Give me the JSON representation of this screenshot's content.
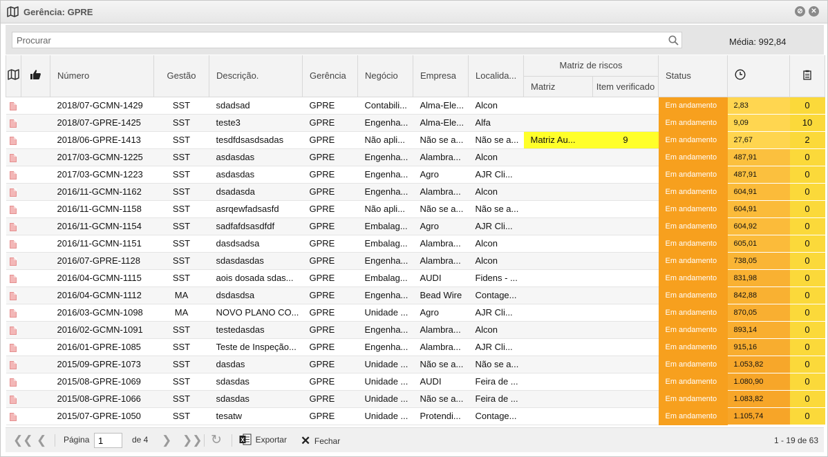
{
  "window": {
    "title": "Gerência: GPRE"
  },
  "search": {
    "placeholder": "Procurar",
    "media_label": "Média:",
    "media_value": "992,84"
  },
  "columns": {
    "numero": "Número",
    "gestao": "Gestão",
    "descricao": "Descrição.",
    "gerencia": "Gerência",
    "negocio": "Negócio",
    "empresa": "Empresa",
    "localidade": "Localida...",
    "matriz_group": "Matriz de riscos",
    "matriz": "Matriz",
    "item_verificado": "Item verificado",
    "status": "Status"
  },
  "rows": [
    {
      "numero": "2018/07-GCMN-1429",
      "gestao": "SST",
      "descricao": "sdadsad",
      "gerencia": "GPRE",
      "negocio": "Contabili...",
      "empresa": "Alma-Ele...",
      "localidade": "Alcon",
      "matriz": "",
      "item": "",
      "status": "Em andamento",
      "dias": "2,83",
      "qtd": "0"
    },
    {
      "numero": "2018/07-GPRE-1425",
      "gestao": "SST",
      "descricao": "teste3",
      "gerencia": "GPRE",
      "negocio": "Engenha...",
      "empresa": "Alma-Ele...",
      "localidade": "Alfa",
      "matriz": "",
      "item": "",
      "status": "Em andamento",
      "dias": "9,09",
      "qtd": "10"
    },
    {
      "numero": "2018/06-GPRE-1413",
      "gestao": "SST",
      "descricao": "tesdfdsasdsadas",
      "gerencia": "GPRE",
      "negocio": "Não apli...",
      "empresa": "Não se a...",
      "localidade": "Não se a...",
      "matriz": "Matriz Au...",
      "item": "9",
      "status": "Em andamento",
      "dias": "27,67",
      "qtd": "2"
    },
    {
      "numero": "2017/03-GCMN-1225",
      "gestao": "SST",
      "descricao": "asdasdas",
      "gerencia": "GPRE",
      "negocio": "Engenha...",
      "empresa": "Alambra...",
      "localidade": "Alcon",
      "matriz": "",
      "item": "",
      "status": "Em andamento",
      "dias": "487,91",
      "qtd": "0"
    },
    {
      "numero": "2017/03-GCMN-1223",
      "gestao": "SST",
      "descricao": "asdasdas",
      "gerencia": "GPRE",
      "negocio": "Engenha...",
      "empresa": "Agro",
      "localidade": "AJR Cli...",
      "matriz": "",
      "item": "",
      "status": "Em andamento",
      "dias": "487,91",
      "qtd": "0"
    },
    {
      "numero": "2016/11-GCMN-1162",
      "gestao": "SST",
      "descricao": "dsadasda",
      "gerencia": "GPRE",
      "negocio": "Engenha...",
      "empresa": "Alambra...",
      "localidade": "Alcon",
      "matriz": "",
      "item": "",
      "status": "Em andamento",
      "dias": "604,91",
      "qtd": "0"
    },
    {
      "numero": "2016/11-GCMN-1158",
      "gestao": "SST",
      "descricao": "asrqewfadsasfd",
      "gerencia": "GPRE",
      "negocio": "Não apli...",
      "empresa": "Não se a...",
      "localidade": "Não se a...",
      "matriz": "",
      "item": "",
      "status": "Em andamento",
      "dias": "604,91",
      "qtd": "0"
    },
    {
      "numero": "2016/11-GCMN-1154",
      "gestao": "SST",
      "descricao": "sadfafdsasdfdf",
      "gerencia": "GPRE",
      "negocio": "Embalag...",
      "empresa": "Agro",
      "localidade": "AJR Cli...",
      "matriz": "",
      "item": "",
      "status": "Em andamento",
      "dias": "604,92",
      "qtd": "0"
    },
    {
      "numero": "2016/11-GCMN-1151",
      "gestao": "SST",
      "descricao": "dasdsadsa",
      "gerencia": "GPRE",
      "negocio": "Embalag...",
      "empresa": "Alambra...",
      "localidade": "Alcon",
      "matriz": "",
      "item": "",
      "status": "Em andamento",
      "dias": "605,01",
      "qtd": "0"
    },
    {
      "numero": "2016/07-GPRE-1128",
      "gestao": "SST",
      "descricao": "sdasdasdas",
      "gerencia": "GPRE",
      "negocio": "Engenha...",
      "empresa": "Alambra...",
      "localidade": "Alcon",
      "matriz": "",
      "item": "",
      "status": "Em andamento",
      "dias": "738,05",
      "qtd": "0"
    },
    {
      "numero": "2016/04-GCMN-1115",
      "gestao": "SST",
      "descricao": "aois dosada sdas...",
      "gerencia": "GPRE",
      "negocio": "Embalag...",
      "empresa": "AUDI",
      "localidade": "Fidens - ...",
      "matriz": "",
      "item": "",
      "status": "Em andamento",
      "dias": "831,98",
      "qtd": "0"
    },
    {
      "numero": "2016/04-GCMN-1112",
      "gestao": "MA",
      "descricao": "dsdasdsa",
      "gerencia": "GPRE",
      "negocio": "Engenha...",
      "empresa": "Bead Wire",
      "localidade": "Contage...",
      "matriz": "",
      "item": "",
      "status": "Em andamento",
      "dias": "842,88",
      "qtd": "0"
    },
    {
      "numero": "2016/03-GCMN-1098",
      "gestao": "MA",
      "descricao": "NOVO PLANO CO...",
      "gerencia": "GPRE",
      "negocio": "Unidade ...",
      "empresa": "Agro",
      "localidade": "AJR Cli...",
      "matriz": "",
      "item": "",
      "status": "Em andamento",
      "dias": "870,05",
      "qtd": "0"
    },
    {
      "numero": "2016/02-GCMN-1091",
      "gestao": "SST",
      "descricao": "testedasdas",
      "gerencia": "GPRE",
      "negocio": "Engenha...",
      "empresa": "Alambra...",
      "localidade": "Alcon",
      "matriz": "",
      "item": "",
      "status": "Em andamento",
      "dias": "893,14",
      "qtd": "0"
    },
    {
      "numero": "2016/01-GPRE-1085",
      "gestao": "SST",
      "descricao": "Teste de Inspeção...",
      "gerencia": "GPRE",
      "negocio": "Engenha...",
      "empresa": "Alambra...",
      "localidade": "AJR Cli...",
      "matriz": "",
      "item": "",
      "status": "Em andamento",
      "dias": "915,16",
      "qtd": "0"
    },
    {
      "numero": "2015/09-GPRE-1073",
      "gestao": "SST",
      "descricao": "dasdas",
      "gerencia": "GPRE",
      "negocio": "Unidade ...",
      "empresa": "Não se a...",
      "localidade": "Não se a...",
      "matriz": "",
      "item": "",
      "status": "Em andamento",
      "dias": "1.053,82",
      "qtd": "0"
    },
    {
      "numero": "2015/08-GPRE-1069",
      "gestao": "SST",
      "descricao": "sdasdas",
      "gerencia": "GPRE",
      "negocio": "Unidade ...",
      "empresa": "AUDI",
      "localidade": "Feira de ...",
      "matriz": "",
      "item": "",
      "status": "Em andamento",
      "dias": "1.080,90",
      "qtd": "0"
    },
    {
      "numero": "2015/08-GPRE-1066",
      "gestao": "SST",
      "descricao": "sdasdas",
      "gerencia": "GPRE",
      "negocio": "Unidade ...",
      "empresa": "Não se a...",
      "localidade": "Feira de ...",
      "matriz": "",
      "item": "",
      "status": "Em andamento",
      "dias": "1.083,82",
      "qtd": "0"
    },
    {
      "numero": "2015/07-GPRE-1050",
      "gestao": "SST",
      "descricao": "tesatw",
      "gerencia": "GPRE",
      "negocio": "Unidade ...",
      "empresa": "Protendi...",
      "localidade": "Contage...",
      "matriz": "",
      "item": "",
      "status": "Em andamento",
      "dias": "1.105,74",
      "qtd": "0"
    }
  ],
  "footer": {
    "page_label": "Página",
    "page_value": "1",
    "of_label": "de 4",
    "export_label": "Exportar",
    "close_label": "Fechar",
    "count": "1 - 19 de 63"
  },
  "colors": {
    "status": "#f7a01e",
    "highlight": "#ffff2a"
  }
}
